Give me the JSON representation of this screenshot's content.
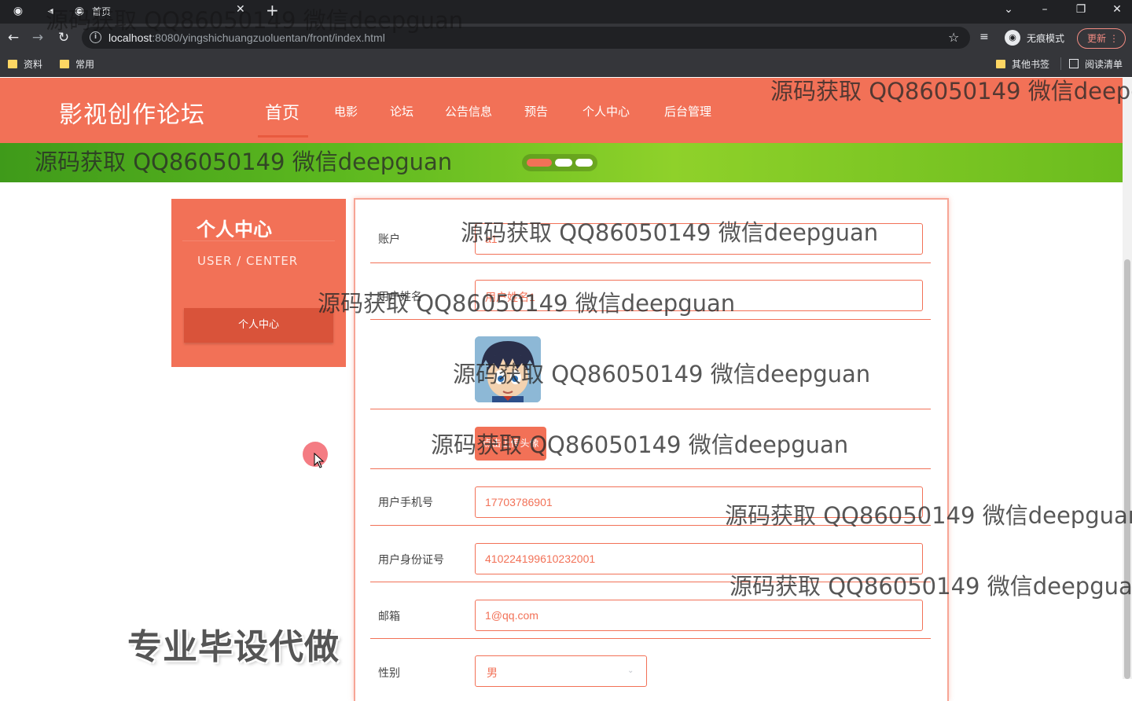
{
  "browser": {
    "tab_title": "首页",
    "url_host": "localhost",
    "url_path": ":8080/yingshichuangzuoluentan/front/index.html",
    "incognito_label": "无痕模式",
    "update_label": "更新",
    "bookmarks": [
      "资料",
      "常用"
    ],
    "bookmarks_right": [
      "其他书签",
      "阅读清单"
    ]
  },
  "site": {
    "title": "影视创作论坛",
    "nav": [
      "首页",
      "电影",
      "论坛",
      "公告信息",
      "预告",
      "个人中心",
      "后台管理"
    ],
    "active_nav": "首页"
  },
  "sidebar": {
    "title": "个人中心",
    "subtitle": "USER / CENTER",
    "button": "个人中心"
  },
  "form": {
    "account_label": "账户",
    "account_value": "a1",
    "name_label": "用户姓名",
    "name_value": "用户姓名1",
    "upload_button": "点击上传头像",
    "phone_label": "用户手机号",
    "phone_value": "17703786901",
    "idcard_label": "用户身份证号",
    "idcard_value": "410224199610232001",
    "email_label": "邮箱",
    "email_value": "1@qq.com",
    "gender_label": "性别",
    "gender_value": "男"
  },
  "watermark": "源码获取 QQ86050149 微信deepguan",
  "promo": "专业毕设代做",
  "colors": {
    "accent": "#f27157",
    "accent_dark": "#d9533a",
    "banner": "#6bbc1e"
  }
}
